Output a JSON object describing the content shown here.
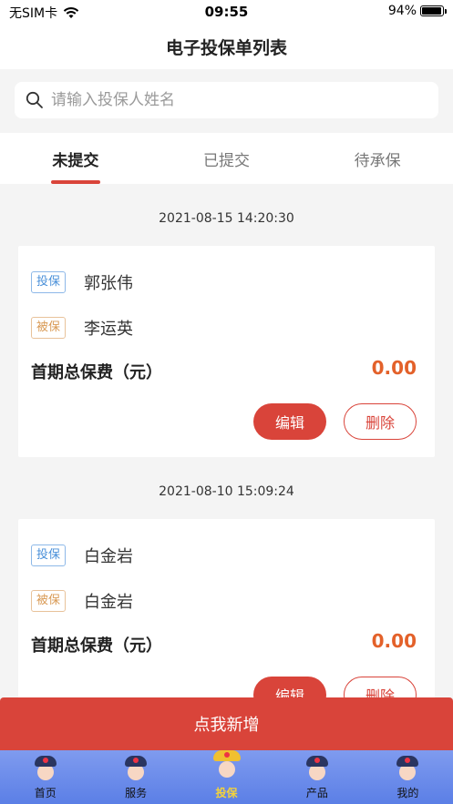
{
  "status": {
    "carrier": "无SIM卡",
    "time": "09:55",
    "battery": "94%",
    "battery_level": 0.94
  },
  "header": {
    "title": "电子投保单列表"
  },
  "search": {
    "placeholder": "请输入投保人姓名"
  },
  "tabs": [
    {
      "label": "未提交",
      "active": true
    },
    {
      "label": "已提交",
      "active": false
    },
    {
      "label": "待承保",
      "active": false
    }
  ],
  "records": [
    {
      "date": "2021-08-15 14:20:30",
      "applicant_tag": "投保",
      "applicant": "郭张伟",
      "insured_tag": "被保",
      "insured": "李运英",
      "premium_label": "首期总保费（元）",
      "premium": "0.00",
      "edit_label": "编辑",
      "delete_label": "删除"
    },
    {
      "date": "2021-08-10 15:09:24",
      "applicant_tag": "投保",
      "applicant": "白金岩",
      "insured_tag": "被保",
      "insured": "白金岩",
      "premium_label": "首期总保费（元）",
      "premium": "0.00",
      "edit_label": "编辑",
      "delete_label": "删除"
    }
  ],
  "add_button": "点我新增",
  "tabbar": [
    {
      "label": "首页",
      "icon": "home-avatar-icon",
      "active": false
    },
    {
      "label": "服务",
      "icon": "service-avatar-icon",
      "active": false
    },
    {
      "label": "投保",
      "icon": "insure-avatar-icon",
      "active": true
    },
    {
      "label": "产品",
      "icon": "product-avatar-icon",
      "active": false
    },
    {
      "label": "我的",
      "icon": "profile-avatar-icon",
      "active": false
    }
  ],
  "colors": {
    "accent": "#d9443a",
    "premium": "#e3612a",
    "tabbar": "#6b8cea"
  }
}
